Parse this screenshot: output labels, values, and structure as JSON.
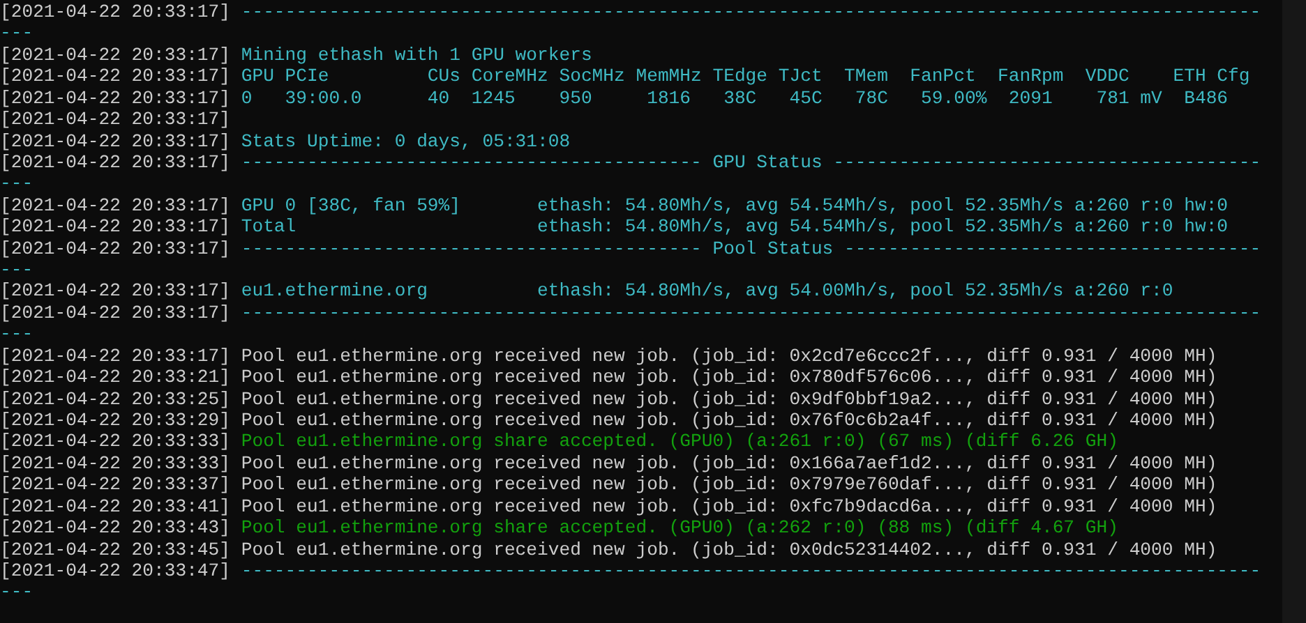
{
  "lines": [
    {
      "timestamp": "[2021-04-22 20:33:17]",
      "text": "---------------------------------------------------------------------------------------------",
      "continuation": "---",
      "kind": "info"
    },
    {
      "timestamp": "[2021-04-22 20:33:17]",
      "text": "Mining ethash with 1 GPU workers",
      "kind": "info"
    },
    {
      "timestamp": "[2021-04-22 20:33:17]",
      "text": "GPU PCIe         CUs CoreMHz SocMHz MemMHz TEdge TJct  TMem  FanPct  FanRpm  VDDC    ETH Cfg",
      "kind": "info"
    },
    {
      "timestamp": "[2021-04-22 20:33:17]",
      "text": "0   39:00.0      40  1245    950     1816   38C   45C   78C   59.00%  2091    781 mV  B486",
      "kind": "info"
    },
    {
      "timestamp": "[2021-04-22 20:33:17]"
    },
    {
      "timestamp": "[2021-04-22 20:33:17]",
      "text": "Stats Uptime: 0 days, 05:31:08",
      "kind": "info"
    },
    {
      "timestamp": "[2021-04-22 20:33:17]",
      "text": "------------------------------------------ GPU Status ---------------------------------------",
      "continuation": "---",
      "kind": "info"
    },
    {
      "timestamp": "[2021-04-22 20:33:17]",
      "text": "GPU 0 [38C, fan 59%]       ethash: 54.80Mh/s, avg 54.54Mh/s, pool 52.35Mh/s a:260 r:0 hw:0",
      "kind": "info"
    },
    {
      "timestamp": "[2021-04-22 20:33:17]",
      "text": "Total                      ethash: 54.80Mh/s, avg 54.54Mh/s, pool 52.35Mh/s a:260 r:0 hw:0",
      "kind": "info"
    },
    {
      "timestamp": "[2021-04-22 20:33:17]",
      "text": "------------------------------------------ Pool Status --------------------------------------",
      "continuation": "---",
      "kind": "info"
    },
    {
      "timestamp": "[2021-04-22 20:33:17]",
      "text": "eu1.ethermine.org          ethash: 54.80Mh/s, avg 54.00Mh/s, pool 52.35Mh/s a:260 r:0",
      "kind": "info"
    },
    {
      "timestamp": "[2021-04-22 20:33:17]",
      "text": "---------------------------------------------------------------------------------------------",
      "continuation": "---",
      "kind": "info"
    },
    {
      "timestamp": "[2021-04-22 20:33:17]",
      "text": "Pool eu1.ethermine.org received new job. (job_id: 0x2cd7e6ccc2f..., diff 0.931 / 4000 MH)",
      "kind": "normal"
    },
    {
      "timestamp": "[2021-04-22 20:33:21]",
      "text": "Pool eu1.ethermine.org received new job. (job_id: 0x780df576c06..., diff 0.931 / 4000 MH)",
      "kind": "normal"
    },
    {
      "timestamp": "[2021-04-22 20:33:25]",
      "text": "Pool eu1.ethermine.org received new job. (job_id: 0x9df0bbf19a2..., diff 0.931 / 4000 MH)",
      "kind": "normal"
    },
    {
      "timestamp": "[2021-04-22 20:33:29]",
      "text": "Pool eu1.ethermine.org received new job. (job_id: 0x76f0c6b2a4f..., diff 0.931 / 4000 MH)",
      "kind": "normal"
    },
    {
      "timestamp": "[2021-04-22 20:33:33]",
      "text": "Pool eu1.ethermine.org share accepted. (GPU0) (a:261 r:0) (67 ms) (diff 6.26 GH)",
      "kind": "accepted"
    },
    {
      "timestamp": "[2021-04-22 20:33:33]",
      "text": "Pool eu1.ethermine.org received new job. (job_id: 0x166a7aef1d2..., diff 0.931 / 4000 MH)",
      "kind": "normal"
    },
    {
      "timestamp": "[2021-04-22 20:33:37]",
      "text": "Pool eu1.ethermine.org received new job. (job_id: 0x7979e760daf..., diff 0.931 / 4000 MH)",
      "kind": "normal"
    },
    {
      "timestamp": "[2021-04-22 20:33:41]",
      "text": "Pool eu1.ethermine.org received new job. (job_id: 0xfc7b9dacd6a..., diff 0.931 / 4000 MH)",
      "kind": "normal"
    },
    {
      "timestamp": "[2021-04-22 20:33:43]",
      "text": "Pool eu1.ethermine.org share accepted. (GPU0) (a:262 r:0) (88 ms) (diff 4.67 GH)",
      "kind": "accepted"
    },
    {
      "timestamp": "[2021-04-22 20:33:45]",
      "text": "Pool eu1.ethermine.org received new job. (job_id: 0x0dc52314402..., diff 0.931 / 4000 MH)",
      "kind": "normal"
    },
    {
      "timestamp": "[2021-04-22 20:33:47]",
      "text": "---------------------------------------------------------------------------------------------",
      "continuation": "---",
      "kind": "info"
    }
  ]
}
